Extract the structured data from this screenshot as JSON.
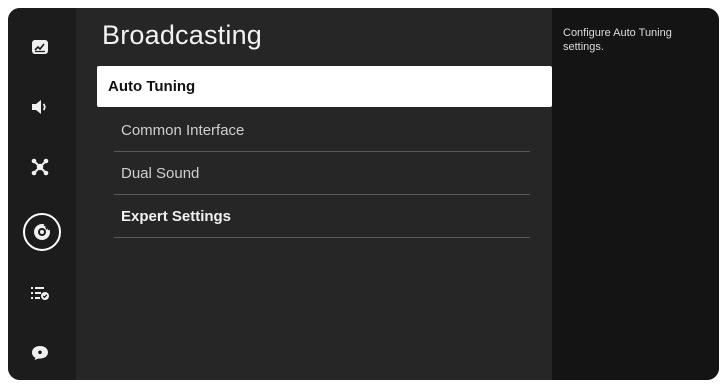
{
  "panel": {
    "title": "Broadcasting"
  },
  "menu": {
    "items": [
      {
        "label": "Auto Tuning",
        "selected": true,
        "bold": true
      },
      {
        "label": "Common Interface",
        "selected": false,
        "bold": false
      },
      {
        "label": "Dual Sound",
        "selected": false,
        "bold": false
      },
      {
        "label": "Expert Settings",
        "selected": false,
        "bold": true
      }
    ]
  },
  "help": {
    "text": "Configure Auto Tuning settings."
  },
  "side_rail": {
    "icons": [
      "picture-icon",
      "sound-icon",
      "broadcasting-icon",
      "general-icon",
      "support-list-icon",
      "help-icon"
    ],
    "active_icon": "broadcasting-icon"
  },
  "colors": {
    "background": "#262626",
    "rail": "#1c1c1c",
    "help_panel": "#141414",
    "selected_item": "#ffffff"
  }
}
